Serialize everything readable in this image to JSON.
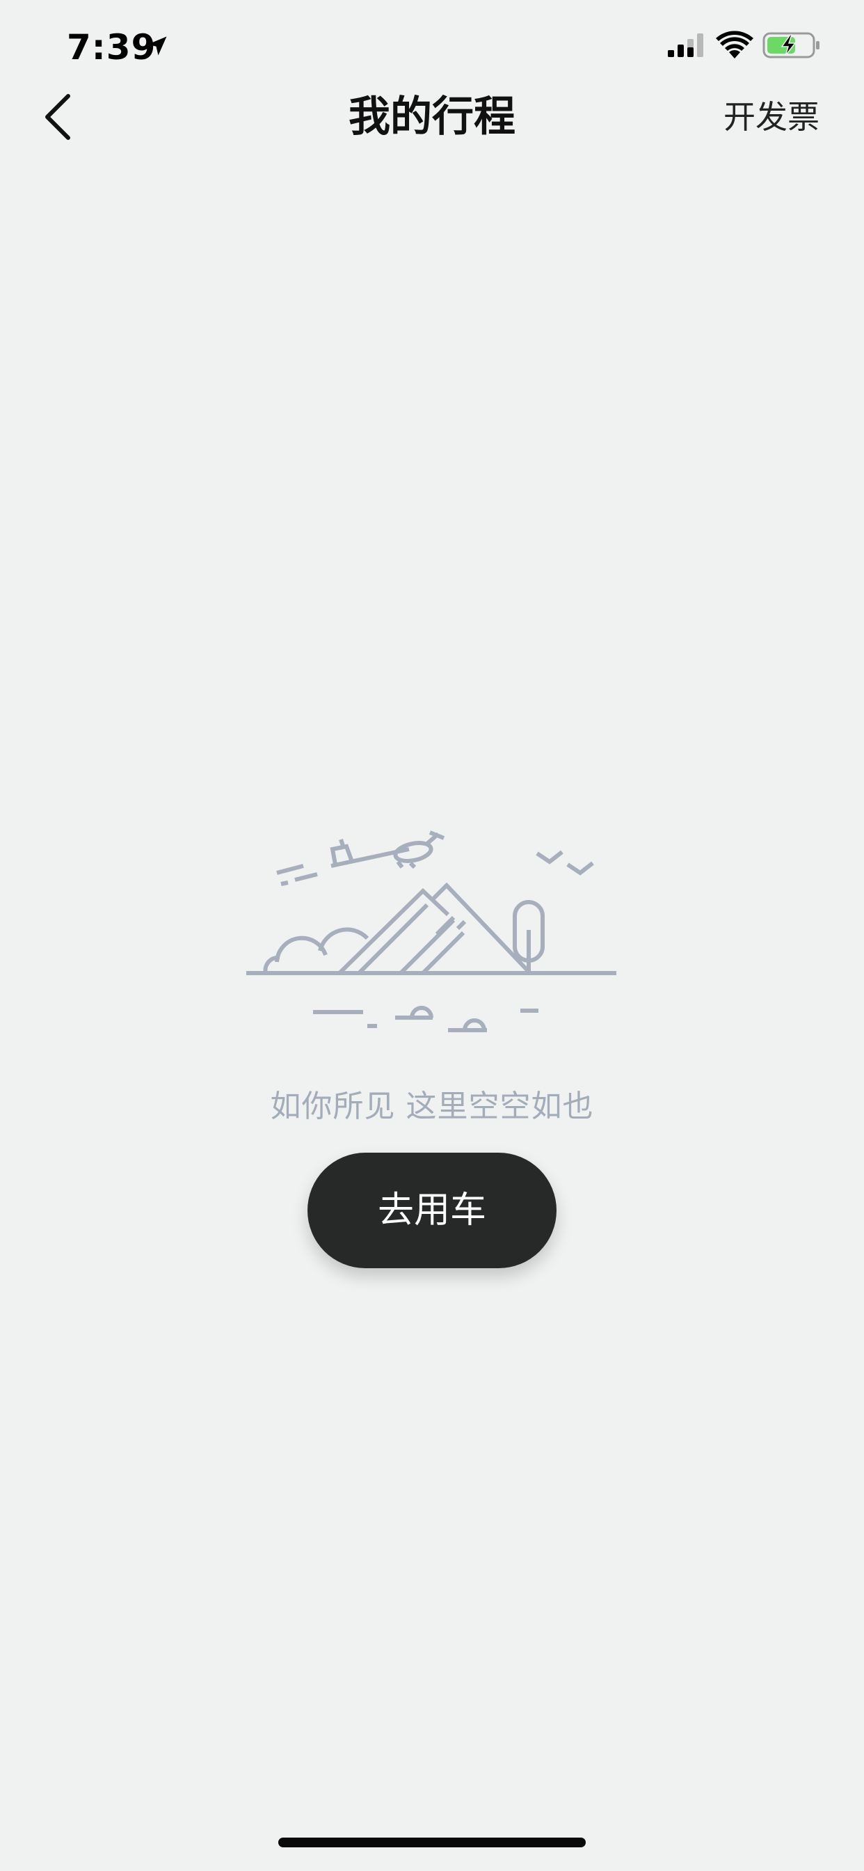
{
  "status_bar": {
    "time": "7:39",
    "icons": [
      "location-arrow-icon",
      "cellular-signal-icon",
      "wifi-icon",
      "battery-charging-icon"
    ]
  },
  "nav": {
    "title": "我的行程",
    "back_icon": "chevron-left-icon",
    "action_label": "开发票"
  },
  "empty_state": {
    "illustration": "mountain-landscape-empty-illustration",
    "message": "如你所见 这里空空如也",
    "cta_label": "去用车"
  },
  "colors": {
    "background": "#eff2f1",
    "illustration": "#a6afbb",
    "empty_text": "#a3acb9",
    "cta_background": "#272828",
    "cta_text": "#ffffff",
    "battery_fill": "#6cd866"
  }
}
